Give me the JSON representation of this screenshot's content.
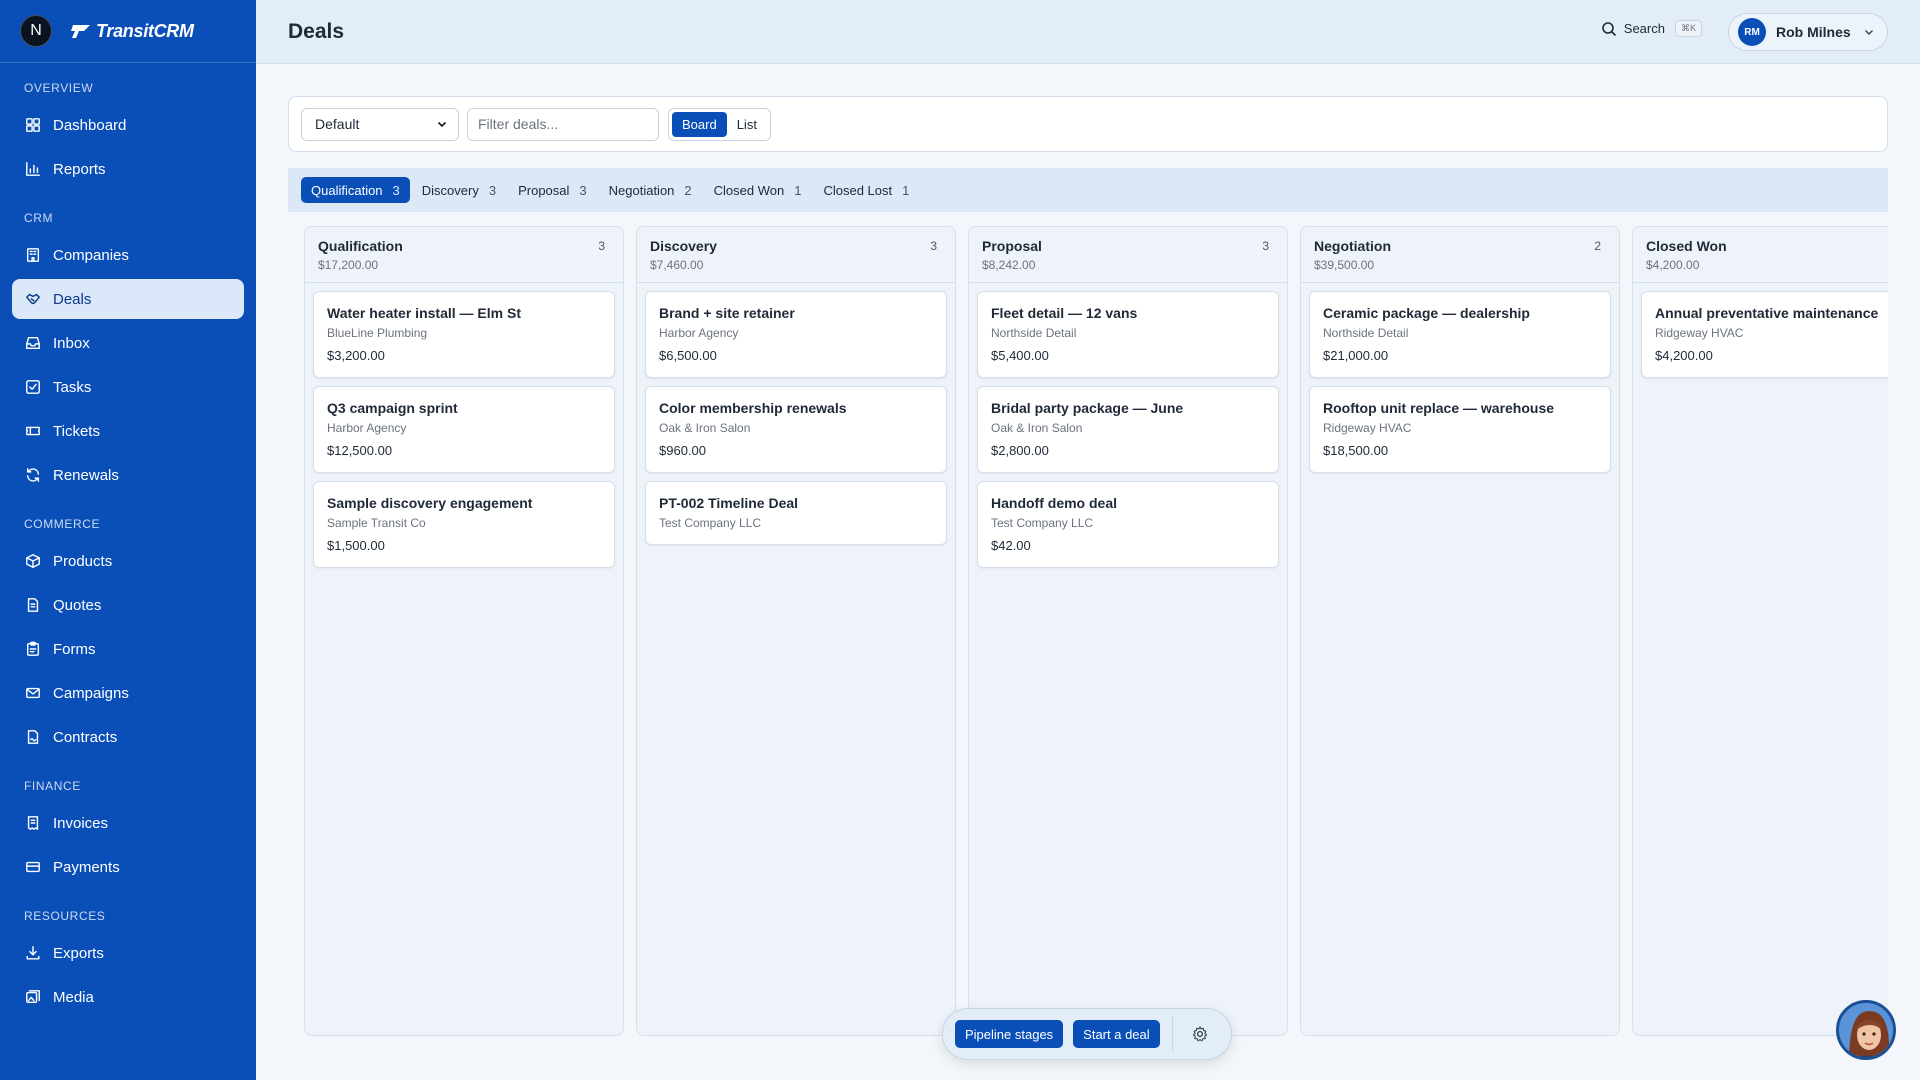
{
  "org": {
    "initial": "N"
  },
  "brand": {
    "name": "TransitCRM"
  },
  "header": {
    "title": "Deals",
    "search_label": "Search",
    "shortcut": "⌘K",
    "user_initials": "RM",
    "user_name": "Rob Milnes"
  },
  "sidebar": {
    "sections": [
      {
        "title": "OVERVIEW",
        "items": [
          {
            "label": "Dashboard",
            "icon": "dashboard-icon"
          },
          {
            "label": "Reports",
            "icon": "bar-chart-icon"
          }
        ]
      },
      {
        "title": "CRM",
        "items": [
          {
            "label": "Companies",
            "icon": "building-icon"
          },
          {
            "label": "Deals",
            "icon": "handshake-icon",
            "active": true
          },
          {
            "label": "Inbox",
            "icon": "inbox-icon"
          },
          {
            "label": "Tasks",
            "icon": "checkbox-icon"
          },
          {
            "label": "Tickets",
            "icon": "ticket-icon"
          },
          {
            "label": "Renewals",
            "icon": "refresh-icon"
          }
        ]
      },
      {
        "title": "COMMERCE",
        "items": [
          {
            "label": "Products",
            "icon": "package-icon"
          },
          {
            "label": "Quotes",
            "icon": "document-icon"
          },
          {
            "label": "Forms",
            "icon": "clipboard-icon"
          },
          {
            "label": "Campaigns",
            "icon": "mail-icon"
          },
          {
            "label": "Contracts",
            "icon": "contract-icon"
          }
        ]
      },
      {
        "title": "FINANCE",
        "items": [
          {
            "label": "Invoices",
            "icon": "receipt-icon"
          },
          {
            "label": "Payments",
            "icon": "card-icon"
          }
        ]
      },
      {
        "title": "RESOURCES",
        "items": [
          {
            "label": "Exports",
            "icon": "download-icon"
          },
          {
            "label": "Media",
            "icon": "media-icon"
          }
        ]
      }
    ]
  },
  "toolbar": {
    "pipeline_value": "Default",
    "filter_placeholder": "Filter deals...",
    "board_label": "Board",
    "list_label": "List"
  },
  "stage_tabs": [
    {
      "label": "Qualification",
      "count": "3",
      "active": true
    },
    {
      "label": "Discovery",
      "count": "3"
    },
    {
      "label": "Proposal",
      "count": "3"
    },
    {
      "label": "Negotiation",
      "count": "2"
    },
    {
      "label": "Closed Won",
      "count": "1"
    },
    {
      "label": "Closed Lost",
      "count": "1"
    }
  ],
  "columns": [
    {
      "title": "Qualification",
      "total": "$17,200.00",
      "count": "3",
      "deals": [
        {
          "title": "Water heater install — Elm St",
          "company": "BlueLine Plumbing",
          "amount": "$3,200.00"
        },
        {
          "title": "Q3 campaign sprint",
          "company": "Harbor Agency",
          "amount": "$12,500.00"
        },
        {
          "title": "Sample discovery engagement",
          "company": "Sample Transit Co",
          "amount": "$1,500.00"
        }
      ]
    },
    {
      "title": "Discovery",
      "total": "$7,460.00",
      "count": "3",
      "deals": [
        {
          "title": "Brand + site retainer",
          "company": "Harbor Agency",
          "amount": "$6,500.00"
        },
        {
          "title": "Color membership renewals",
          "company": "Oak & Iron Salon",
          "amount": "$960.00"
        },
        {
          "title": "PT-002 Timeline Deal",
          "company": "Test Company LLC",
          "amount": ""
        }
      ]
    },
    {
      "title": "Proposal",
      "total": "$8,242.00",
      "count": "3",
      "deals": [
        {
          "title": "Fleet detail — 12 vans",
          "company": "Northside Detail",
          "amount": "$5,400.00"
        },
        {
          "title": "Bridal party package — June",
          "company": "Oak & Iron Salon",
          "amount": "$2,800.00"
        },
        {
          "title": "Handoff demo deal",
          "company": "Test Company LLC",
          "amount": "$42.00"
        }
      ]
    },
    {
      "title": "Negotiation",
      "total": "$39,500.00",
      "count": "2",
      "deals": [
        {
          "title": "Ceramic package — dealership",
          "company": "Northside Detail",
          "amount": "$21,000.00"
        },
        {
          "title": "Rooftop unit replace — warehouse",
          "company": "Ridgeway HVAC",
          "amount": "$18,500.00"
        }
      ]
    },
    {
      "title": "Closed Won",
      "total": "$4,200.00",
      "count": "",
      "deals": [
        {
          "title": "Annual preventative maintenance",
          "company": "Ridgeway HVAC",
          "amount": "$4,200.00"
        }
      ]
    }
  ],
  "actions": {
    "pipeline_stages": "Pipeline stages",
    "start_deal": "Start a deal"
  }
}
